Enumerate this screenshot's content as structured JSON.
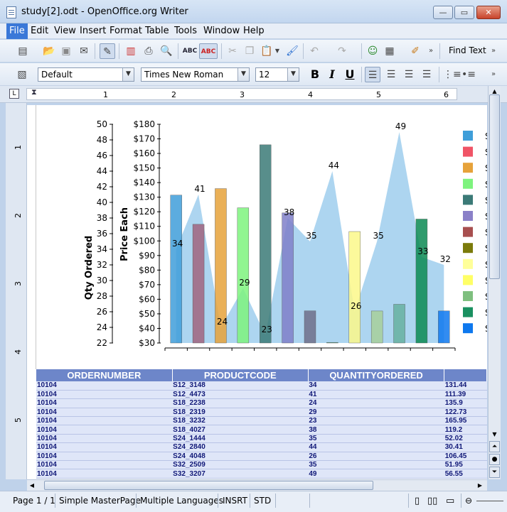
{
  "window": {
    "title": "study[2].odt - OpenOffice.org Writer",
    "min": "—",
    "max": "▭",
    "close": "✕"
  },
  "menus": [
    "File",
    "Edit",
    "View",
    "Insert",
    "Format",
    "Table",
    "Tools",
    "Window",
    "Help"
  ],
  "toolbar": {
    "find_text": "Find Text"
  },
  "format_bar": {
    "style": "Default",
    "font": "Times New Roman",
    "size": "12",
    "bold": "B",
    "italic": "I",
    "underline": "U"
  },
  "ruler": {
    "marks": [
      "1",
      "2",
      "3",
      "4",
      "5",
      "6"
    ],
    "vmarks": [
      "1",
      "2",
      "3",
      "4",
      "5"
    ]
  },
  "chart_data": {
    "type": "bar",
    "left_axis_label": "Qty Ordered",
    "right_axis_label": "Price Each",
    "qty_ticks": [
      "50",
      "48",
      "46",
      "44",
      "42",
      "40",
      "38",
      "36",
      "34",
      "32",
      "30",
      "28",
      "26",
      "24",
      "22"
    ],
    "price_ticks": [
      "$180",
      "$170",
      "$160",
      "$150",
      "$140",
      "$130",
      "$120",
      "$110",
      "$100",
      "$90",
      "$80",
      "$70",
      "$60",
      "$50",
      "$40",
      "$30"
    ],
    "ylim_price": [
      30,
      180
    ],
    "ylim_qty": [
      22,
      50
    ],
    "prices": [
      131.44,
      111.39,
      135.9,
      122.73,
      165.95,
      119.2,
      52.02,
      30.41,
      106.45,
      51.95,
      56.55,
      115.0,
      52.0
    ],
    "bar_colors": [
      "#3f9ed9",
      "#a0647f",
      "#e6a23a",
      "#7ef37e",
      "#3b7a77",
      "#7f7fc9",
      "#6f6f8a",
      "#3c9a6a",
      "#fbf88a",
      "#a7cf9a",
      "#66b0a0",
      "#0b8a52",
      "#0e78ee"
    ],
    "qty_area": [
      34,
      41,
      24,
      29,
      23,
      38,
      35,
      44,
      26,
      35,
      49,
      33,
      32
    ],
    "qty_labels": [
      "34",
      "41",
      "24",
      "29",
      "23",
      "38",
      "35",
      "44",
      "26",
      "35",
      "49",
      "33",
      "32"
    ],
    "legend_colors": [
      "#3f9ed9",
      "#f05466",
      "#e6a23a",
      "#7ef37e",
      "#3b7a77",
      "#8a80c8",
      "#a84f4f",
      "#7b7b0b",
      "#ffff99",
      "#ffff66",
      "#7fbf7f",
      "#1a9060",
      "#0e78ee"
    ],
    "legend_labels": [
      "S",
      "S",
      "S",
      "S",
      "S",
      "S",
      "S",
      "S",
      "S",
      "S",
      "S",
      "S",
      "S"
    ]
  },
  "table": {
    "headers": [
      "ORDERNUMBER",
      "PRODUCTCODE",
      "QUANTITYORDERED",
      ""
    ],
    "rows": [
      [
        "10104",
        "S12_3148",
        "34",
        "131.44"
      ],
      [
        "10104",
        "S12_4473",
        "41",
        "111.39"
      ],
      [
        "10104",
        "S18_2238",
        "24",
        "135.9"
      ],
      [
        "10104",
        "S18_2319",
        "29",
        "122.73"
      ],
      [
        "10104",
        "S18_3232",
        "23",
        "165.95"
      ],
      [
        "10104",
        "S18_4027",
        "38",
        "119.2"
      ],
      [
        "10104",
        "S24_1444",
        "35",
        "52.02"
      ],
      [
        "10104",
        "S24_2840",
        "44",
        "30.41"
      ],
      [
        "10104",
        "S24_4048",
        "26",
        "106.45"
      ],
      [
        "10104",
        "S32_2509",
        "35",
        "51.95"
      ],
      [
        "10104",
        "S32_3207",
        "49",
        "56.55"
      ]
    ]
  },
  "status": {
    "page": "Page 1 / 1",
    "master": "Simple MasterPage",
    "lang": "Multiple Languages",
    "insert": "INSRT",
    "std": "STD"
  }
}
